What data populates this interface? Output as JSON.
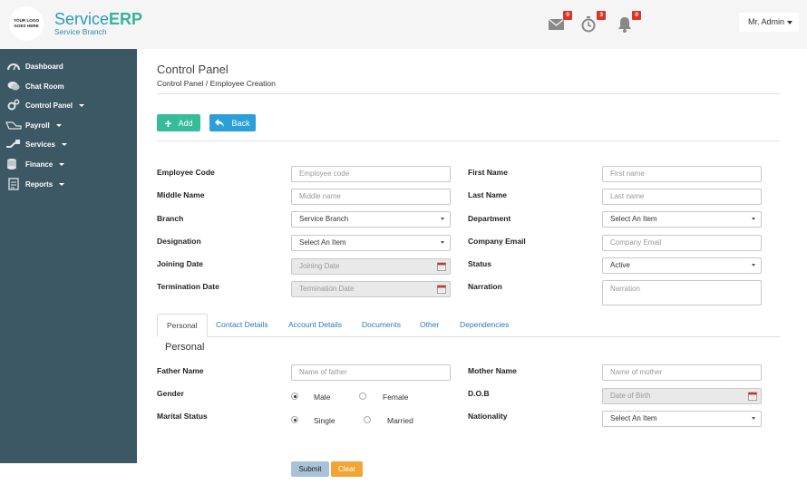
{
  "header": {
    "logo_text": "YOUR LOGO GOES HERE",
    "brand_service": "Service",
    "brand_erp": "ERP",
    "brand_sub": "Service Branch",
    "notifications": {
      "mail_count": "0",
      "timer_count": "3",
      "bell_count": "0"
    },
    "user_label": "Mr. Admin"
  },
  "sidebar": {
    "items": [
      {
        "label": "Dashboard",
        "icon": "dashboard-icon"
      },
      {
        "label": "Chat Room",
        "icon": "chat-icon"
      },
      {
        "label": "Control Panel",
        "icon": "gears-icon"
      },
      {
        "label": "Payroll",
        "icon": "payroll-icon"
      },
      {
        "label": "Services",
        "icon": "services-icon"
      },
      {
        "label": "Finance",
        "icon": "finance-icon"
      },
      {
        "label": "Reports",
        "icon": "reports-icon"
      }
    ]
  },
  "page": {
    "title": "Control Panel",
    "breadcrumb": "Control Panel / Employee Creation",
    "add_label": "Add",
    "back_label": "Back"
  },
  "form": {
    "employee_code": {
      "label": "Employee Code",
      "placeholder": "Employee code"
    },
    "first_name": {
      "label": "First Name",
      "placeholder": "First name"
    },
    "middle_name": {
      "label": "Middle Name",
      "placeholder": "Middle name"
    },
    "last_name": {
      "label": "Last Name",
      "placeholder": "Last name"
    },
    "branch": {
      "label": "Branch",
      "value": "Service Branch"
    },
    "department": {
      "label": "Department",
      "value": "Select An Item"
    },
    "designation": {
      "label": "Designation",
      "value": "Select An Item"
    },
    "company_email": {
      "label": "Company Email",
      "placeholder": "Company Email"
    },
    "joining_date": {
      "label": "Joining Date",
      "placeholder": "Joining Date"
    },
    "status": {
      "label": "Status",
      "value": "Active"
    },
    "termination_date": {
      "label": "Termination Date",
      "placeholder": "Termination Date"
    },
    "narration": {
      "label": "Narration",
      "placeholder": "Narration"
    }
  },
  "tabs": [
    "Personal",
    "Contact Details",
    "Account Details",
    "Documents",
    "Other",
    "Dependencies"
  ],
  "personal": {
    "title": "Personal",
    "father_name": {
      "label": "Father Name",
      "placeholder": "Name of father"
    },
    "mother_name": {
      "label": "Mother Name",
      "placeholder": "Name of mother"
    },
    "gender": {
      "label": "Gender",
      "option_1": "Male",
      "option_2": "Female"
    },
    "dob": {
      "label": "D.O.B",
      "placeholder": "Date of Birth"
    },
    "marital_status": {
      "label": "Marital Status",
      "option_1": "Single",
      "option_2": "Married"
    },
    "nationality": {
      "label": "Nationality",
      "value": "Select An Item"
    }
  },
  "actions": {
    "submit_label": "Submit",
    "clear_label": "Clear"
  },
  "colors": {
    "sidebar_bg": "#3c5864",
    "add_button": "#37bc9b",
    "back_button": "#2b9fd9",
    "badge": "#d9342b",
    "clear_button": "#f0a535",
    "submit_button": "#a9c2d8",
    "brand": "#2a9ab8"
  }
}
